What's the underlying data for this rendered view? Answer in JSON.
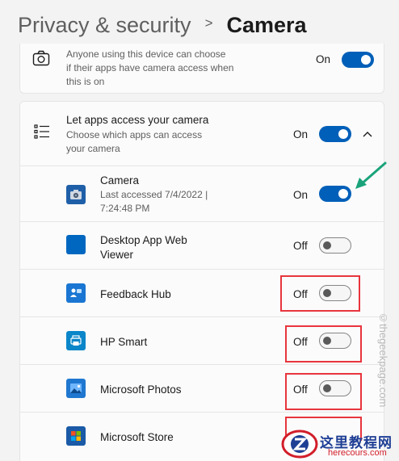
{
  "header": {
    "crumb": "Privacy & security",
    "separator": ">",
    "current": "Camera"
  },
  "device_access": {
    "description_line1": "Anyone using this device can choose",
    "description_line2": "if their apps have camera access when",
    "description_line3": "this is on",
    "state": "On",
    "toggle_on": true,
    "icon": "camera-outline-icon"
  },
  "apps_access": {
    "title": "Let apps access your camera",
    "description_line1": "Choose which apps can access",
    "description_line2": "your camera",
    "state": "On",
    "toggle_on": true,
    "icon": "list-icon",
    "expand_icon": "chevron-up-icon"
  },
  "apps": [
    {
      "name": "Camera",
      "meta_line1": "Last accessed 7/4/2022  |",
      "meta_line2": "7:24:48 PM",
      "state": "On",
      "toggle_on": true,
      "icon": "camera-app-icon",
      "icon_color": "#1f5fa8"
    },
    {
      "name_line1": "Desktop App Web",
      "name_line2": "Viewer",
      "state": "Off",
      "toggle_on": false,
      "icon": "desktop-app-web-viewer-icon",
      "icon_color": "#0067c0"
    },
    {
      "name": "Feedback Hub",
      "state": "Off",
      "toggle_on": false,
      "icon": "feedback-hub-icon",
      "icon_color": "#1a76d2"
    },
    {
      "name": "HP Smart",
      "state": "Off",
      "toggle_on": false,
      "icon": "hp-smart-icon",
      "icon_color": "#0a86c9"
    },
    {
      "name": "Microsoft Photos",
      "state": "Off",
      "toggle_on": false,
      "icon": "microsoft-photos-icon",
      "icon_color": "#1f77d0"
    },
    {
      "name": "Microsoft Store",
      "state": "Off",
      "toggle_on": false,
      "icon": "microsoft-store-icon",
      "icon_color": "#1a5aa6"
    }
  ],
  "annotations": {
    "arrow_color": "#1aa37a",
    "highlight_color": "#e8353d"
  },
  "watermark": {
    "side_text": "©thegeekpage.com",
    "logo_text": "这里教程网",
    "logo_domain": "herecours.com"
  },
  "colors": {
    "accent": "#005fb8",
    "background": "#f3f3f3",
    "card": "#fbfbfb"
  }
}
